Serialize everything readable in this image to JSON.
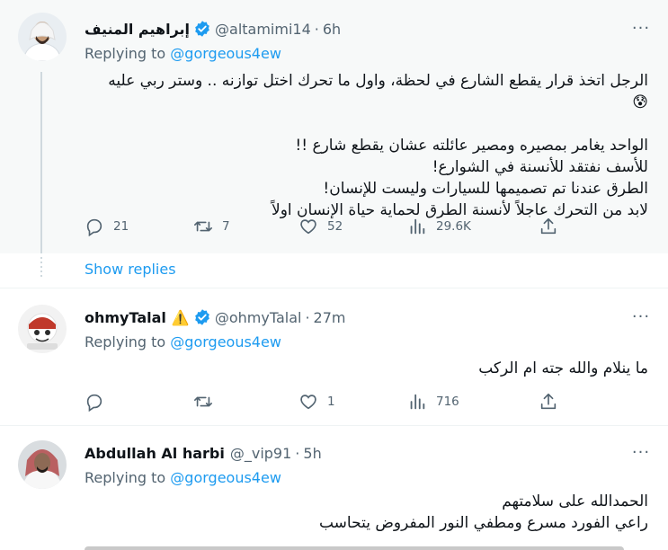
{
  "colors": {
    "accent": "#1d9bf0",
    "secondary_text": "#536471",
    "primary_text": "#0f1419",
    "highlight_bg": "#f7f9f9",
    "warning": "#ffac33"
  },
  "tweets": [
    {
      "name": "إبراهيم المنيف",
      "verified": true,
      "handle": "@altamimi14",
      "separator": "·",
      "time": "6h",
      "more": "···",
      "replying_prefix": "Replying to",
      "replying_to": "@gorgeous4ew",
      "lines": [
        "الرجل اتخذ قرار يقطع الشارع في لحظة، واول ما تحرك اختل توازنه .. وستر ربي عليه",
        "😰",
        "",
        "الواحد يغامر بمصيره ومصير عائلته عشان يقطع شارع !!",
        "للأسف نفتقد للأنسنة في الشوارع!",
        "الطرق عندنا تم تصميمها للسيارات وليست للإنسان!",
        "لابد من التحرك عاجلاً لأنسنة الطرق لحماية حياة الإنسان اولاً"
      ],
      "stats": {
        "replies": "21",
        "retweets": "7",
        "likes": "52",
        "views": "29.6K"
      }
    },
    {
      "name": "ohmyTalal",
      "name_emoji": "⚠️",
      "verified": true,
      "handle": "@ohmyTalal",
      "separator": "·",
      "time": "27m",
      "more": "···",
      "replying_prefix": "Replying to",
      "replying_to": "@gorgeous4ew",
      "lines": [
        "ما ينلام والله جته ام الركب"
      ],
      "stats": {
        "replies": "",
        "retweets": "",
        "likes": "1",
        "views": "716"
      }
    },
    {
      "name": "Abdullah Al harbi",
      "verified": false,
      "handle": "@_vip91",
      "separator": "·",
      "time": "5h",
      "more": "···",
      "replying_prefix": "Replying to",
      "replying_to": "@gorgeous4ew",
      "lines": [
        "الحمدالله على سلامتهم",
        "راعي الفورد مسرع ومطفي النور المفروض يتحاسب"
      ]
    }
  ],
  "show_replies": "Show replies",
  "icons": [
    "reply-icon",
    "retweet-icon",
    "like-icon",
    "views-icon",
    "share-icon",
    "verified-badge-icon",
    "more-icon"
  ]
}
